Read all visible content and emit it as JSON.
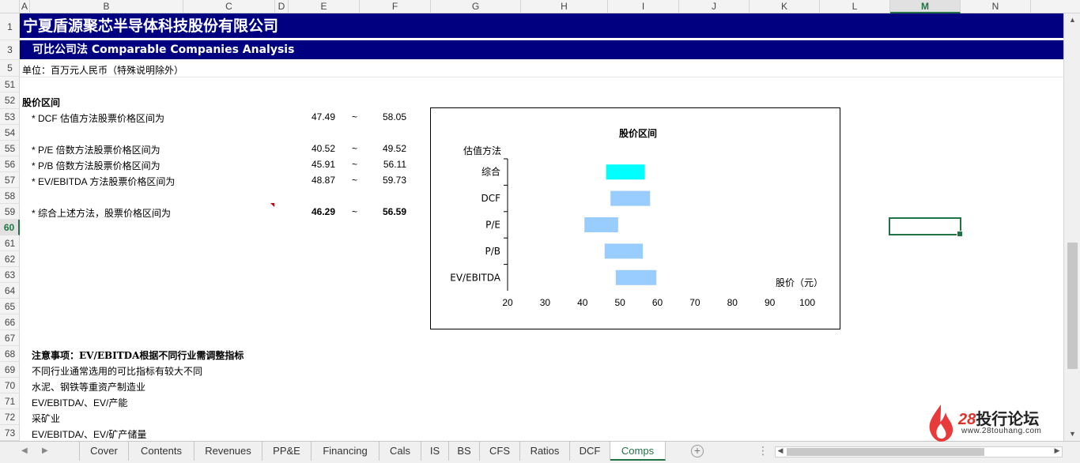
{
  "columns": [
    "A",
    "B",
    "C",
    "D",
    "E",
    "F",
    "G",
    "H",
    "I",
    "J",
    "K",
    "L",
    "M",
    "N"
  ],
  "selected_column": "M",
  "rows": [
    "1",
    "3",
    "5",
    "51",
    "52",
    "53",
    "54",
    "55",
    "56",
    "57",
    "58",
    "59",
    "60",
    "61",
    "62",
    "63",
    "64",
    "65",
    "66",
    "67",
    "68",
    "69",
    "70",
    "71",
    "72",
    "73"
  ],
  "selected_row": "60",
  "sheet": {
    "title": "宁夏盾源聚芯半导体科技股份有限公司",
    "subtitle": "可比公司法 Comparable Companies Analysis",
    "unit": "单位：百万元人民币（特殊说明除外）",
    "section_heading": "股价区间",
    "ranges": [
      {
        "label": "* DCF 估值方法股票价格区间为",
        "low": "47.49",
        "sep": "~",
        "high": "58.05",
        "bold": false
      },
      {
        "label": "* P/E 倍数方法股票价格区间为",
        "low": "40.52",
        "sep": "~",
        "high": "49.52",
        "bold": false
      },
      {
        "label": "* P/B 倍数方法股票价格区间为",
        "low": "45.91",
        "sep": "~",
        "high": "56.11",
        "bold": false
      },
      {
        "label": "* EV/EBITDA 方法股票价格区间为",
        "low": "48.87",
        "sep": "~",
        "high": "59.73",
        "bold": false
      },
      {
        "label": "* 综合上述方法，股票价格区间为",
        "low": "46.29",
        "sep": "~",
        "high": "56.59",
        "bold": true
      }
    ],
    "notes_heading": "注意事项：EV/EBITDA根据不同行业需调整指标",
    "notes": [
      "不同行业通常选用的可比指标有较大不同",
      "水泥、钢铁等重资产制造业",
      "EV/EBITDA/、EV/产能",
      "采矿业",
      "EV/EBITDA/、EV/矿产储量"
    ]
  },
  "chart_data": {
    "type": "bar",
    "orientation": "horizontal-floating",
    "title": "股价区间",
    "ylabel": "估值方法",
    "xlabel": "股价（元）",
    "categories": [
      "综合",
      "DCF",
      "P/E",
      "P/B",
      "EV/EBITDA"
    ],
    "ranges": [
      [
        46.29,
        56.59
      ],
      [
        47.49,
        58.05
      ],
      [
        40.52,
        49.52
      ],
      [
        45.91,
        56.11
      ],
      [
        48.87,
        59.73
      ]
    ],
    "colors": [
      "#00ffff",
      "#99ccff",
      "#99ccff",
      "#99ccff",
      "#99ccff"
    ],
    "xlim": [
      20,
      100
    ],
    "xticks": [
      "20",
      "30",
      "40",
      "50",
      "60",
      "70",
      "80",
      "90",
      "100"
    ],
    "grid": false,
    "legend": "none"
  },
  "tabs": [
    "Cover",
    "Contents",
    "Revenues",
    "PP&E",
    "Financing",
    "Cals",
    "IS",
    "BS",
    "CFS",
    "Ratios",
    "DCF",
    "Comps"
  ],
  "active_tab": "Comps",
  "watermark": {
    "brand_num": "28",
    "brand_text": "投行论坛",
    "url": "www.28touhang.com"
  }
}
